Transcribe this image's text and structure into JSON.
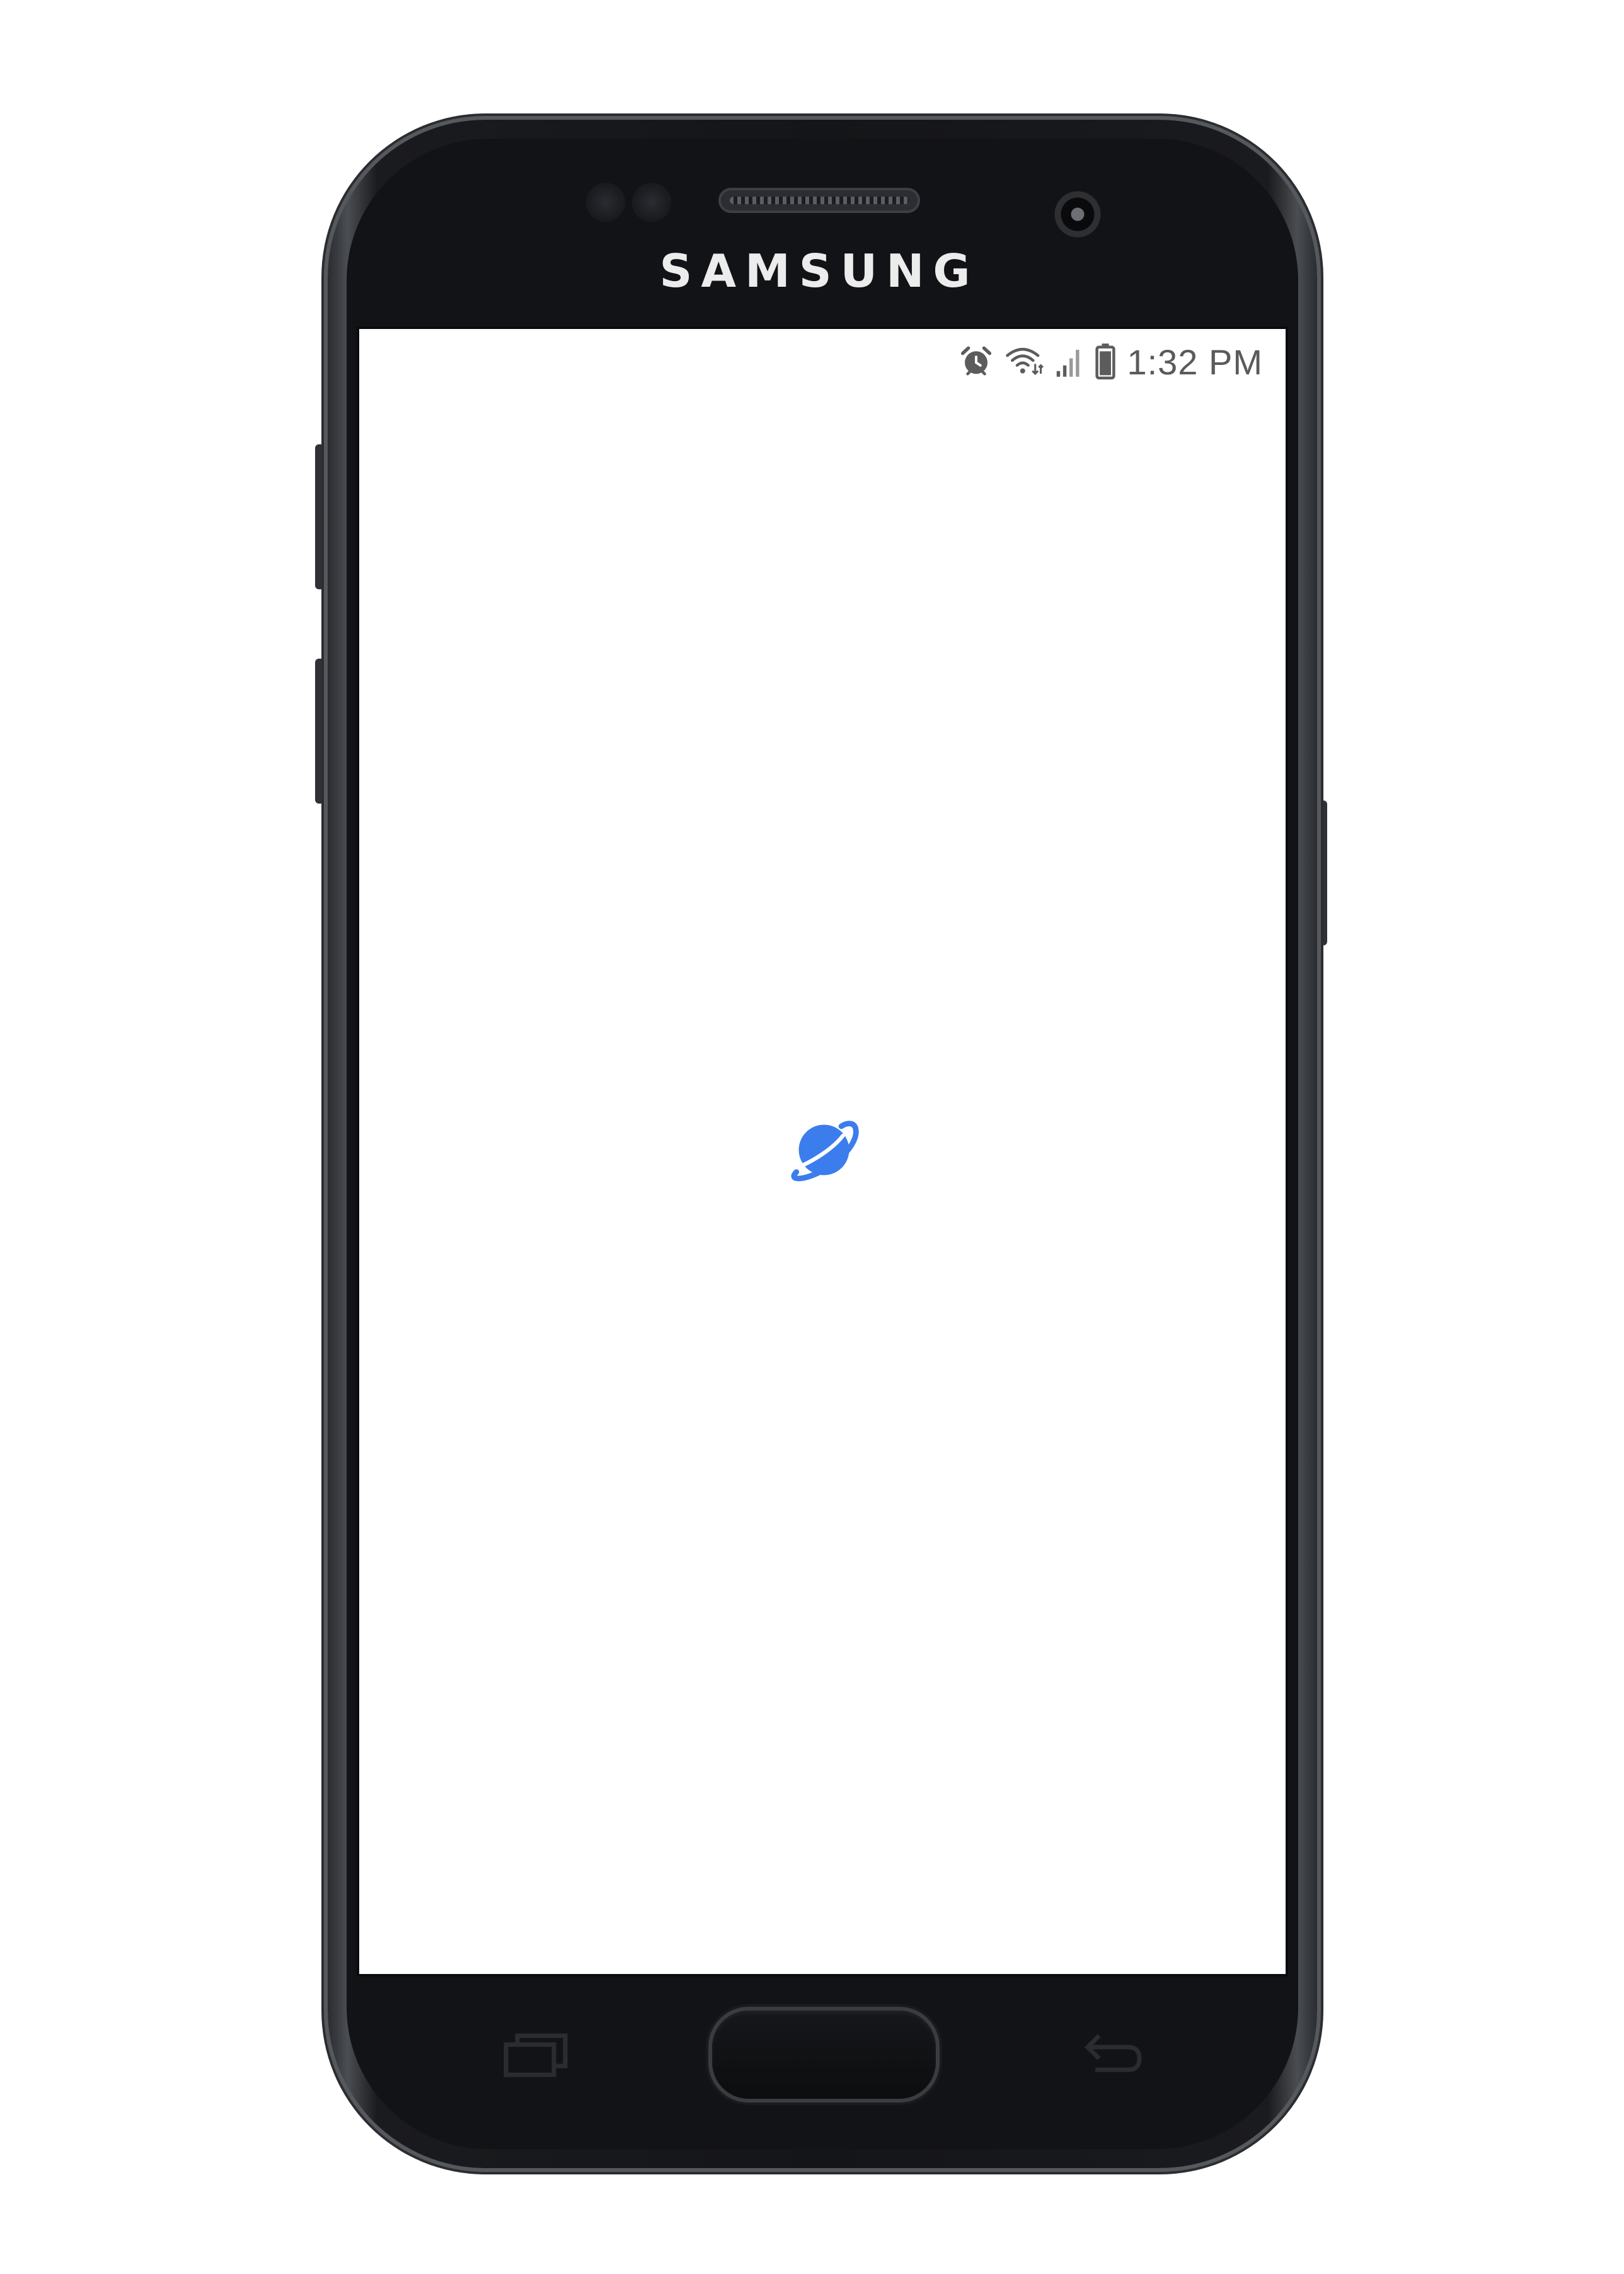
{
  "device": {
    "brand": "SAMSUNG"
  },
  "status_bar": {
    "time": "1:32 PM",
    "icons": [
      "alarm-icon",
      "wifi-icon",
      "signal-icon",
      "battery-icon"
    ]
  },
  "screen": {
    "background": "#ffffff",
    "loading_logo": {
      "icon": "planet-icon",
      "color": "#3b7ded"
    }
  },
  "navigation": {
    "recent_apps": "recent-apps-icon",
    "home": "home-button",
    "back": "back-icon"
  }
}
